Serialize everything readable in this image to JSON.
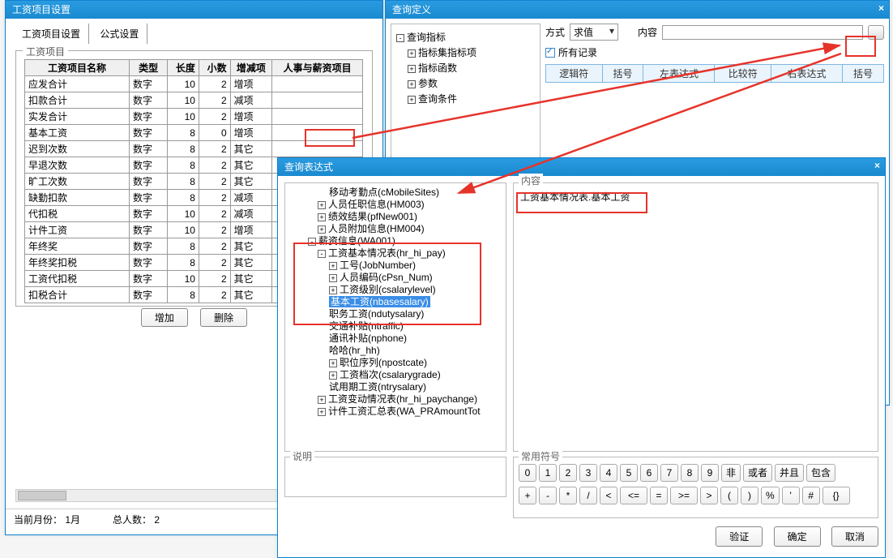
{
  "win1": {
    "title": "工资项目设置",
    "tabs": [
      "工资项目设置",
      "公式设置"
    ],
    "fieldset_label": "工资项目",
    "headers": [
      "工资项目名称",
      "类型",
      "长度",
      "小数",
      "增减项",
      "人事与薪资项目"
    ],
    "rows": [
      {
        "name": "应发合计",
        "type": "数字",
        "len": "10",
        "dec": "2",
        "inc": "增项",
        "proj": ""
      },
      {
        "name": "扣款合计",
        "type": "数字",
        "len": "10",
        "dec": "2",
        "inc": "减项",
        "proj": ""
      },
      {
        "name": "实发合计",
        "type": "数字",
        "len": "10",
        "dec": "2",
        "inc": "增项",
        "proj": ""
      },
      {
        "name": "基本工资",
        "type": "数字",
        "len": "8",
        "dec": "0",
        "inc": "增项",
        "proj": ""
      },
      {
        "name": "迟到次数",
        "type": "数字",
        "len": "8",
        "dec": "2",
        "inc": "其它",
        "proj": ""
      },
      {
        "name": "早退次数",
        "type": "数字",
        "len": "8",
        "dec": "2",
        "inc": "其它",
        "proj": ""
      },
      {
        "name": "旷工次数",
        "type": "数字",
        "len": "8",
        "dec": "2",
        "inc": "其它",
        "proj": ""
      },
      {
        "name": "缺勤扣款",
        "type": "数字",
        "len": "8",
        "dec": "2",
        "inc": "减项",
        "proj": ""
      },
      {
        "name": "代扣税",
        "type": "数字",
        "len": "10",
        "dec": "2",
        "inc": "减项",
        "proj": ""
      },
      {
        "name": "计件工资",
        "type": "数字",
        "len": "10",
        "dec": "2",
        "inc": "增项",
        "proj": ""
      },
      {
        "name": "年终奖",
        "type": "数字",
        "len": "8",
        "dec": "2",
        "inc": "其它",
        "proj": ""
      },
      {
        "name": "年终奖扣税",
        "type": "数字",
        "len": "8",
        "dec": "2",
        "inc": "其它",
        "proj": ""
      },
      {
        "name": "工资代扣税",
        "type": "数字",
        "len": "10",
        "dec": "2",
        "inc": "其它",
        "proj": ""
      },
      {
        "name": "扣税合计",
        "type": "数字",
        "len": "8",
        "dec": "2",
        "inc": "其它",
        "proj": ""
      }
    ],
    "btn_add": "增加",
    "btn_del": "删除",
    "status_month_label": "当前月份：",
    "status_month": "1月",
    "status_count_label": "总人数：",
    "status_count": "2"
  },
  "win2": {
    "title": "查询定义",
    "tree_root": "查询指标",
    "tree_items": [
      "指标集指标项",
      "指标函数",
      "参数",
      "查询条件"
    ],
    "way_label": "方式",
    "way_value": "求值",
    "content_label": "内容",
    "all_records": "所有记录",
    "cond_headers": [
      "逻辑符",
      "括号",
      "左表达式",
      "比较符",
      "右表达式",
      "括号"
    ]
  },
  "win3": {
    "title": "查询表达式",
    "tree_rows": [
      {
        "lvl": 3,
        "sq": "",
        "text": "移动考勤点(cMobileSites)"
      },
      {
        "lvl": 2,
        "sq": "+",
        "text": "人员任职信息(HM003)"
      },
      {
        "lvl": 2,
        "sq": "+",
        "text": "绩效结果(pfNew001)"
      },
      {
        "lvl": 2,
        "sq": "+",
        "text": "人员附加信息(HM004)"
      },
      {
        "lvl": 1,
        "sq": "-",
        "text": "薪资信息(WA001)"
      },
      {
        "lvl": 2,
        "sq": "-",
        "text": "工资基本情况表(hr_hi_pay)"
      },
      {
        "lvl": 3,
        "sq": "+",
        "text": "工号(JobNumber)"
      },
      {
        "lvl": 3,
        "sq": "+",
        "text": "人员编码(cPsn_Num)"
      },
      {
        "lvl": 3,
        "sq": "+",
        "text": "工资级别(csalarylevel)"
      },
      {
        "lvl": 3,
        "sq": "",
        "text": "基本工资(nbasesalary)",
        "sel": true
      },
      {
        "lvl": 3,
        "sq": "",
        "text": "职务工资(ndutysalary)"
      },
      {
        "lvl": 3,
        "sq": "",
        "text": "交通补贴(ntraffic)"
      },
      {
        "lvl": 3,
        "sq": "",
        "text": "通讯补贴(nphone)"
      },
      {
        "lvl": 3,
        "sq": "",
        "text": "哈哈(hr_hh)"
      },
      {
        "lvl": 3,
        "sq": "+",
        "text": "职位序列(npostcate)"
      },
      {
        "lvl": 3,
        "sq": "+",
        "text": "工资档次(csalarygrade)"
      },
      {
        "lvl": 3,
        "sq": "",
        "text": "试用期工资(ntrysalary)"
      },
      {
        "lvl": 2,
        "sq": "+",
        "text": "工资变动情况表(hr_hi_paychange)"
      },
      {
        "lvl": 2,
        "sq": "+",
        "text": "计件工资汇总表(WA_PRAmountTot"
      }
    ],
    "content_label": "内容",
    "content_text": "工资基本情况表.基本工资",
    "desc_label": "说明",
    "sym_label": "常用符号",
    "symbols_row1": [
      "0",
      "1",
      "2",
      "3",
      "4",
      "5",
      "6",
      "7",
      "8",
      "9",
      "非",
      "或者",
      "并且",
      "包含"
    ],
    "symbols_row2": [
      "+",
      "-",
      "*",
      "/",
      "<",
      "<=",
      "=",
      ">=",
      ">",
      "(",
      ")",
      "%",
      "'",
      "#",
      "{}"
    ],
    "btn_verify": "验证",
    "btn_ok": "确定",
    "btn_cancel": "取消"
  }
}
